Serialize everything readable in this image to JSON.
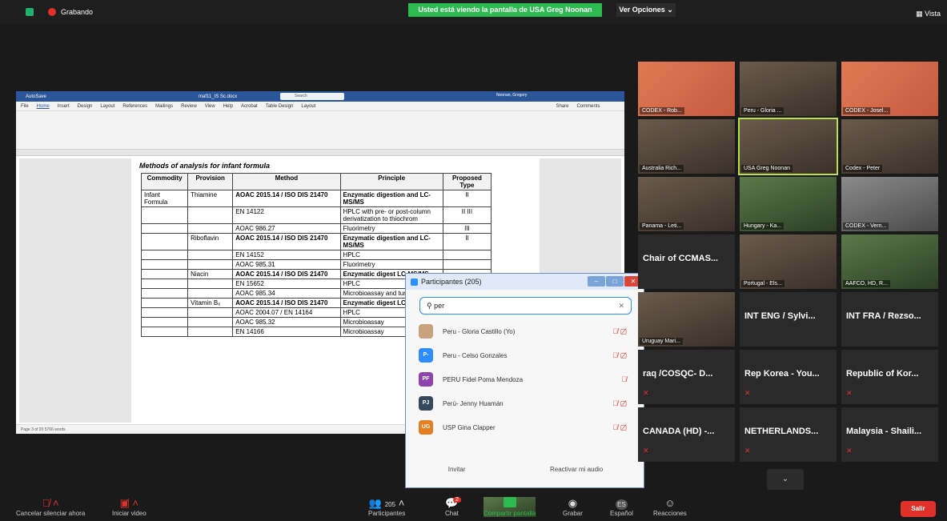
{
  "topbar": {
    "recording": "Grabando",
    "banner": "Usted está viendo la pantalla de USA Greg Noonan",
    "view_options": "Ver Opciones ⌄",
    "view": "Vista"
  },
  "word": {
    "title": "AutoSave",
    "filename": "maf11_IS Sc.docx",
    "search": "Search",
    "user": "Noonan, Gregory",
    "menu": [
      "File",
      "Home",
      "Insert",
      "Design",
      "Layout",
      "References",
      "Mailings",
      "Review",
      "View",
      "Help",
      "Acrobat",
      "Table Design",
      "Layout"
    ],
    "share": "Share",
    "comments": "Comments",
    "status": "Page 3 of 20    5766 words",
    "heading": "Methods of analysis for infant formula",
    "headers": [
      "Commodity",
      "Provision",
      "Method",
      "Principle",
      "Proposed Type"
    ],
    "rows": [
      {
        "commodity": "Infant Formula",
        "provision": "Thiamine",
        "method": "AOAC 2015.14 / ISO DIS 21470",
        "principle": "Enzymatic digestion and LC-MS/MS",
        "type": "II",
        "bold": true
      },
      {
        "commodity": "",
        "provision": "",
        "method": "EN 14122",
        "principle": "HPLC with pre- or post-column derivatization to thiochrom",
        "type": "II III",
        "bold": false
      },
      {
        "commodity": "",
        "provision": "",
        "method": "AOAC 986.27",
        "principle": "Fluorimetry",
        "type": "III",
        "bold": false
      },
      {
        "commodity": "",
        "provision": "Riboflavin",
        "method": "AOAC 2015.14 / ISO DIS 21470",
        "principle": "Enzymatic digestion and LC-MS/MS",
        "type": "II",
        "bold": true
      },
      {
        "commodity": "",
        "provision": "",
        "method": "EN 14152",
        "principle": "HPLC",
        "type": "",
        "bold": false
      },
      {
        "commodity": "",
        "provision": "",
        "method": "AOAC 985.31",
        "principle": "Fluorimetry",
        "type": "",
        "bold": false
      },
      {
        "commodity": "",
        "provision": "Niacin",
        "method": "AOAC 2015.14 / ISO DIS 21470",
        "principle": "Enzymatic digest LC-MS/MS",
        "type": "",
        "bold": true
      },
      {
        "commodity": "",
        "provision": "",
        "method": "EN 15652",
        "principle": "HPLC",
        "type": "",
        "bold": false
      },
      {
        "commodity": "",
        "provision": "",
        "method": "AOAC 985.34",
        "principle": "Microbioassay and turbidimetry",
        "type": "",
        "bold": false
      },
      {
        "commodity": "",
        "provision": "Vitamin B₆",
        "method": "AOAC 2015.14 / ISO DIS 21470",
        "principle": "Enzymatic digest LC-MS/MS",
        "type": "",
        "bold": true
      },
      {
        "commodity": "",
        "provision": "",
        "method": "AOAC 2004.07 / EN 14164",
        "principle": "HPLC",
        "type": "",
        "bold": false
      },
      {
        "commodity": "",
        "provision": "",
        "method": "AOAC 985.32",
        "principle": "Microbioassay",
        "type": "",
        "bold": false
      },
      {
        "commodity": "",
        "provision": "",
        "method": "EN 14166",
        "principle": "Microbioassay",
        "type": "",
        "bold": false
      }
    ]
  },
  "participants": {
    "title": "Participantes (205)",
    "search": "per",
    "list": [
      {
        "initials": "",
        "name": "Peru - Gloria Castillo (Yo)",
        "color": "#c9a27e"
      },
      {
        "initials": "P-",
        "name": "Peru - Celso Gonzales",
        "color": "#2d8cff"
      },
      {
        "initials": "PF",
        "name": "PERU Fidel Poma Mendoza",
        "color": "#8e44ad"
      },
      {
        "initials": "PJ",
        "name": "Perú- Jenny Huamán",
        "color": "#34495e"
      },
      {
        "initials": "UG",
        "name": "USP Gina Clapper",
        "color": "#e67e22"
      }
    ],
    "invite": "Invitar",
    "unmute": "Reactivar mi audio"
  },
  "gallery": [
    {
      "label": "CODEX - Rob...",
      "big": ""
    },
    {
      "label": "Peru - Gloria ...",
      "big": ""
    },
    {
      "label": "CODEX - Josel...",
      "big": ""
    },
    {
      "label": "Australia Rich...",
      "big": ""
    },
    {
      "label": "USA Greg Noonan",
      "big": ""
    },
    {
      "label": "Codex - Peter",
      "big": ""
    },
    {
      "label": "Panama - Leti...",
      "big": ""
    },
    {
      "label": "Hungary - Ka...",
      "big": ""
    },
    {
      "label": "CODEX - Vern...",
      "big": ""
    },
    {
      "label": "",
      "big": "Chair of CCMAS..."
    },
    {
      "label": "Portugal - Els...",
      "big": ""
    },
    {
      "label": "AAFCO, HD, R...",
      "big": ""
    },
    {
      "label": "Uruguay Mari...",
      "big": ""
    },
    {
      "label": "",
      "big": "INT ENG / Sylvi..."
    },
    {
      "label": "",
      "big": "INT FRA / Rezso..."
    },
    {
      "label": "",
      "big": "raq /COSQC- D..."
    },
    {
      "label": "",
      "big": "Rep Korea - You..."
    },
    {
      "label": "",
      "big": "Republic of Kor..."
    },
    {
      "label": "",
      "big": "CANADA (HD) -..."
    },
    {
      "label": "",
      "big": "NETHERLANDS..."
    },
    {
      "label": "",
      "big": "Malaysia - Shaili..."
    }
  ],
  "toolbar": {
    "mute": "Cancelar silenciar ahora",
    "video": "Iniciar video",
    "participants": "Participantes",
    "count": "205",
    "chat": "Chat",
    "chat_badge": "2",
    "share": "Compartir pantalla",
    "record": "Grabar",
    "lang": "Español",
    "lang_code": "ES",
    "reactions": "Reacciones",
    "leave": "Salir"
  }
}
